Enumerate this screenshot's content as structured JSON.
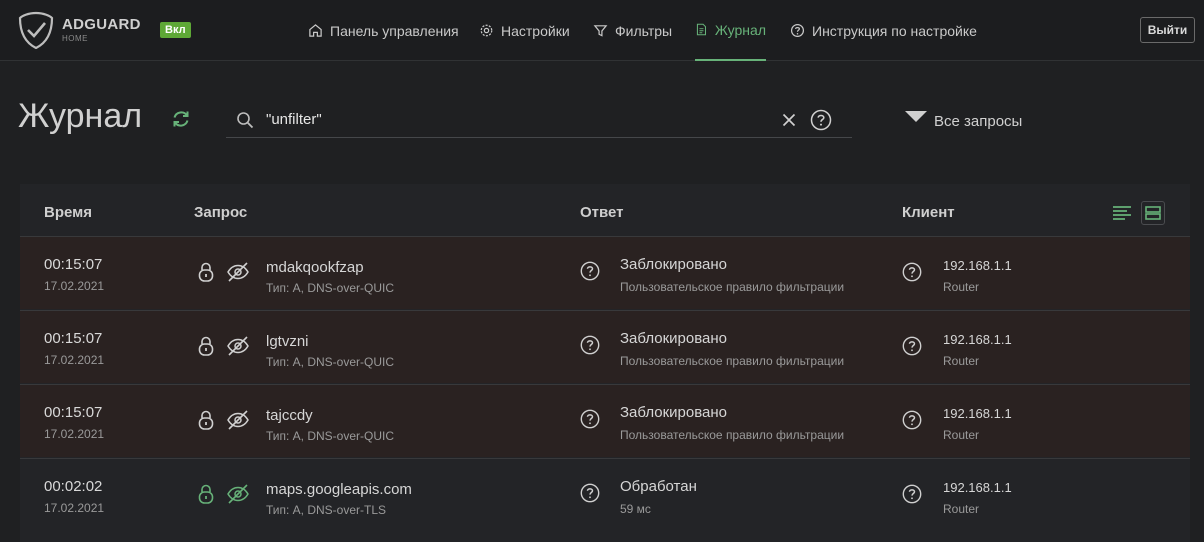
{
  "header": {
    "brand_name": "ADGUARD",
    "brand_sub": "HOME",
    "status_badge": "Вкл",
    "nav": [
      {
        "label": "Панель управления",
        "icon": "home-icon"
      },
      {
        "label": "Настройки",
        "icon": "gear-icon"
      },
      {
        "label": "Фильтры",
        "icon": "filter-icon"
      },
      {
        "label": "Журнал",
        "icon": "document-icon",
        "active": true
      },
      {
        "label": "Инструкция по настройке",
        "icon": "help-icon"
      }
    ],
    "logout_label": "Выйти"
  },
  "page": {
    "title": "Журнал",
    "search_value": "\"unfilter\"",
    "filter_label": "Все запросы"
  },
  "table": {
    "columns": [
      "Время",
      "Запрос",
      "Ответ",
      "Клиент"
    ],
    "rows": [
      {
        "time": "00:15:07",
        "date": "17.02.2021",
        "domain": "mdakqookfzap",
        "type": "Тип: A, DNS-over-QUIC",
        "status": "Заблокировано",
        "detail": "Пользовательское правило фильтрации",
        "client_ip": "192.168.1.1",
        "client_name": "Router",
        "blocked": true
      },
      {
        "time": "00:15:07",
        "date": "17.02.2021",
        "domain": "lgtvzni",
        "type": "Тип: A, DNS-over-QUIC",
        "status": "Заблокировано",
        "detail": "Пользовательское правило фильтрации",
        "client_ip": "192.168.1.1",
        "client_name": "Router",
        "blocked": true
      },
      {
        "time": "00:15:07",
        "date": "17.02.2021",
        "domain": "tajccdy",
        "type": "Тип: A, DNS-over-QUIC",
        "status": "Заблокировано",
        "detail": "Пользовательское правило фильтрации",
        "client_ip": "192.168.1.1",
        "client_name": "Router",
        "blocked": true
      },
      {
        "time": "00:02:02",
        "date": "17.02.2021",
        "domain": "maps.googleapis.com",
        "type": "Тип: A, DNS-over-TLS",
        "status": "Обработан",
        "detail": "59 мс",
        "client_ip": "192.168.1.1",
        "client_name": "Router",
        "blocked": false
      }
    ]
  },
  "colors": {
    "accent": "#67b279",
    "badge": "#5ea836",
    "blocked_row": "#2a2221"
  }
}
